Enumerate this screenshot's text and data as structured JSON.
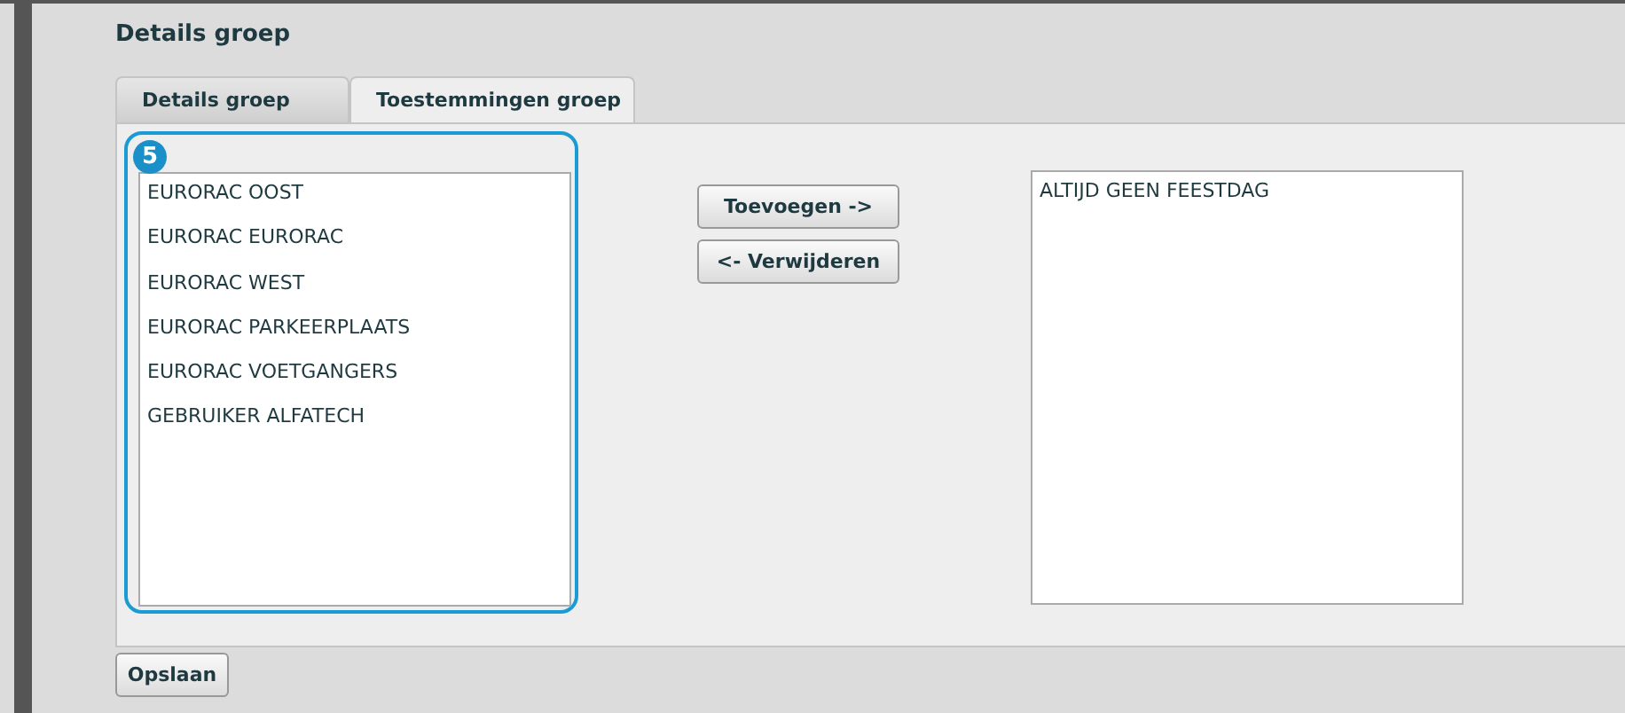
{
  "page_title": "Details groep",
  "tabs": [
    {
      "label": "Details groep",
      "selected": false
    },
    {
      "label": "Toestemmingen groep",
      "selected": true
    }
  ],
  "callout": {
    "number": "5"
  },
  "available_list": {
    "items": [
      "EURORAC OOST",
      "EURORAC EURORAC",
      "EURORAC WEST",
      "EURORAC PARKEERPLAATS",
      "EURORAC VOETGANGERS",
      "GEBRUIKER ALFATECH"
    ]
  },
  "transfer_buttons": [
    "Toevoegen ->",
    "<- Verwijderen"
  ],
  "assigned_list": {
    "items": [
      "ALTIJD GEEN FEESTDAG"
    ]
  },
  "save_button": "Opslaan"
}
